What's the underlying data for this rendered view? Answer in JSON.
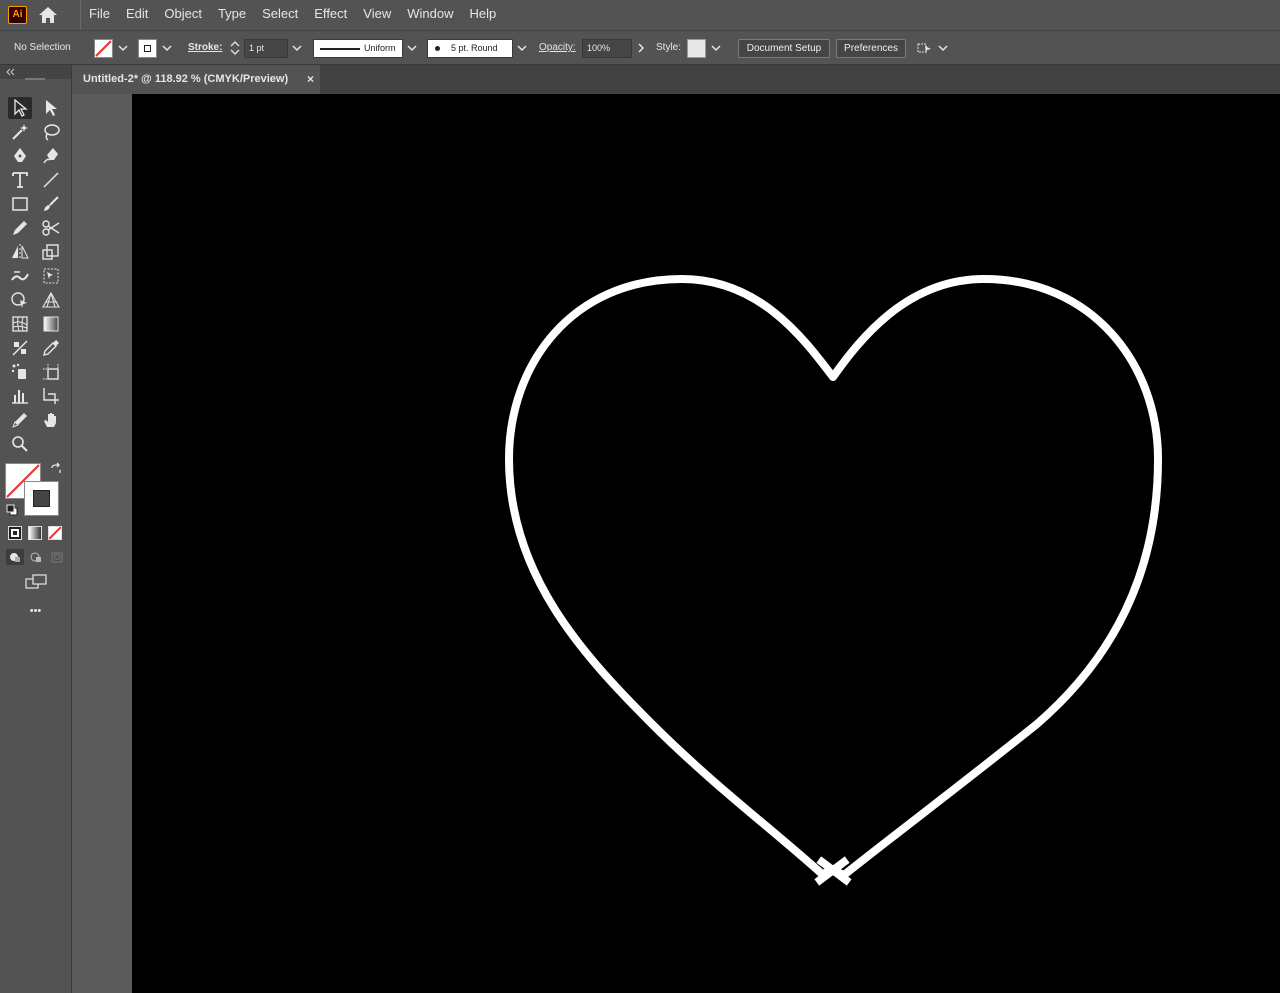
{
  "app": {
    "logo_text": "Ai",
    "menus": [
      "File",
      "Edit",
      "Object",
      "Type",
      "Select",
      "Effect",
      "View",
      "Window",
      "Help"
    ]
  },
  "control_bar": {
    "selection_label": "No Selection",
    "stroke_label": "Stroke:",
    "stroke_weight": "1 pt",
    "stroke_profile": "Uniform",
    "brush": "5 pt. Round",
    "opacity_label": "Opacity:",
    "opacity_value": "100%",
    "style_label": "Style:",
    "document_setup": "Document Setup",
    "preferences": "Preferences"
  },
  "document_tab": {
    "title": "Untitled-2* @ 118.92 % (CMYK/Preview)",
    "close": "×"
  },
  "toolbar": {
    "more": "•••"
  },
  "colors": {
    "ui_bg": "#535353",
    "artboard": "#000000",
    "heart_stroke": "#ffffff",
    "none_slash": "#e8322d"
  }
}
